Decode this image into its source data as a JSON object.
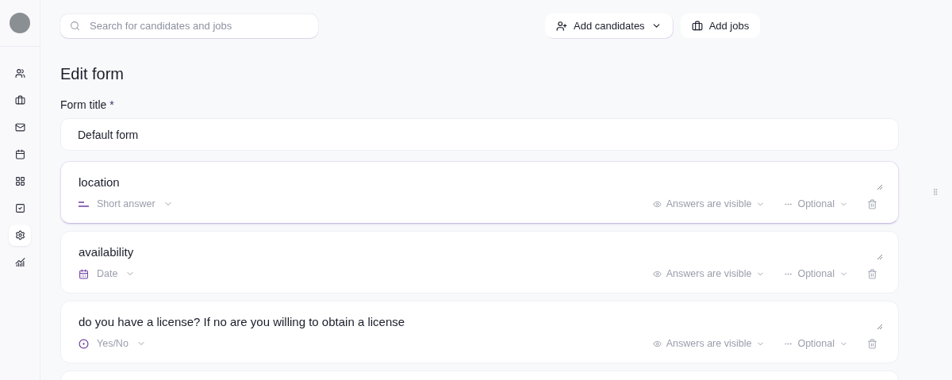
{
  "sidebar": {
    "items": [
      {
        "selected": false
      },
      {
        "selected": false
      },
      {
        "selected": false
      },
      {
        "selected": false
      },
      {
        "selected": false
      },
      {
        "selected": false
      },
      {
        "selected": true
      },
      {
        "selected": false
      }
    ]
  },
  "search": {
    "placeholder": "Search for candidates and jobs"
  },
  "actions": [
    {
      "label": "Add candidates",
      "kind": "dropdown"
    },
    {
      "label": "Add jobs",
      "kind": "plain"
    }
  ],
  "heading": "Edit form",
  "form_title": {
    "label": "Form title",
    "required_mark": "*",
    "value": "Default form"
  },
  "questions": [
    {
      "text": "location",
      "kind": "short",
      "type_label": "Short answer",
      "visibility": "Answers are visible",
      "requirement": "Optional",
      "selected": true
    },
    {
      "text": "availability",
      "kind": "date",
      "type_label": "Date",
      "visibility": "Answers are visible",
      "requirement": "Optional",
      "selected": false
    },
    {
      "text": "do you have a license? If no are you willing to obtain a license",
      "kind": "yesno",
      "type_label": "Yes/No",
      "visibility": "Answers are visible",
      "requirement": "Optional",
      "selected": false
    }
  ]
}
